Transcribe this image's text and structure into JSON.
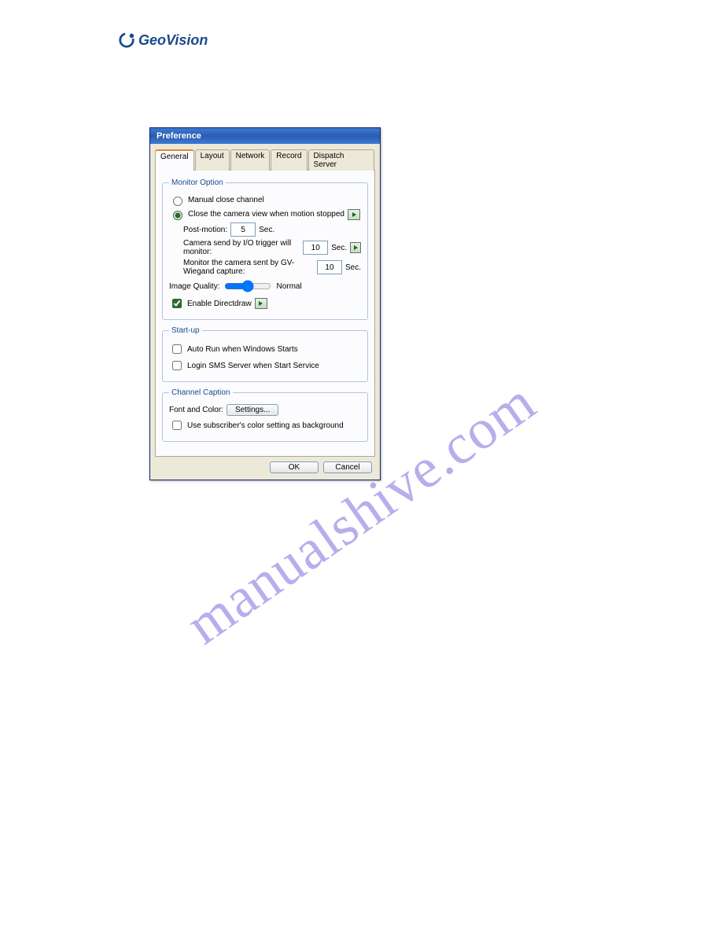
{
  "logo_text": "GeoVision",
  "dialog": {
    "title": "Preference",
    "tabs": [
      "General",
      "Layout",
      "Network",
      "Record",
      "Dispatch Server"
    ],
    "active_tab": "General",
    "groups": {
      "monitor": {
        "legend": "Monitor Option",
        "manual_close": "Manual close channel",
        "close_when_stopped": "Close the camera view when motion stopped",
        "post_motion_label": "Post-motion:",
        "post_motion_value": "5",
        "post_motion_unit": "Sec.",
        "io_trigger_label": "Camera send by I/O trigger will monitor:",
        "io_trigger_value": "10",
        "io_trigger_unit": "Sec.",
        "wiegand_label": "Monitor the camera sent by GV-Wiegand capture:",
        "wiegand_value": "10",
        "wiegand_unit": "Sec.",
        "image_quality_label": "Image Quality:",
        "image_quality_value": "Normal",
        "directdraw_label": "Enable Directdraw"
      },
      "startup": {
        "legend": "Start-up",
        "auto_run": "Auto Run when Windows Starts",
        "login_sms": "Login SMS Server when Start Service"
      },
      "caption": {
        "legend": "Channel Caption",
        "font_color_label": "Font and Color:",
        "settings_btn": "Settings...",
        "use_bg": "Use subscriber's color setting as background"
      }
    },
    "buttons": {
      "ok": "OK",
      "cancel": "Cancel"
    }
  },
  "watermark": "manualshive.com"
}
